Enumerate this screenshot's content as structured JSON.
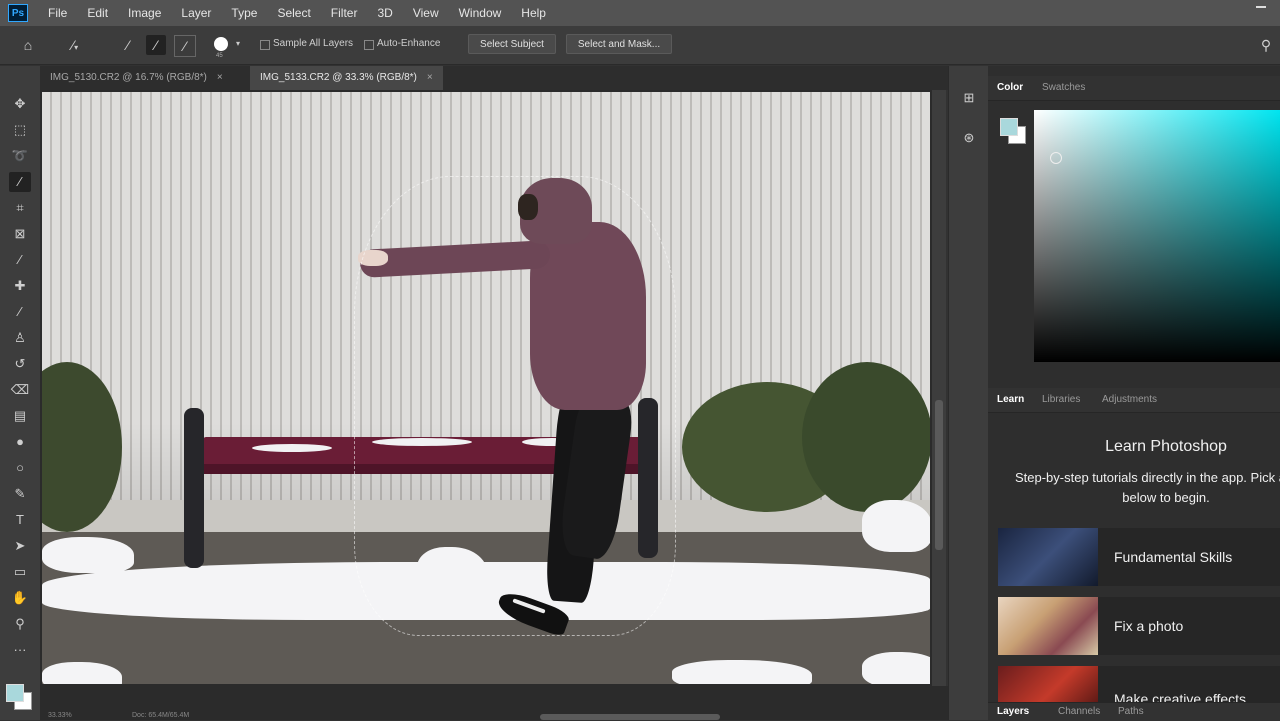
{
  "menu": {
    "logo": "Ps",
    "items": [
      "File",
      "Edit",
      "Image",
      "Layer",
      "Type",
      "Select",
      "Filter",
      "3D",
      "View",
      "Window",
      "Help"
    ]
  },
  "options": {
    "brush_size": "45",
    "sample_all_layers": "Sample All Layers",
    "auto_enhance": "Auto-Enhance",
    "select_subject": "Select Subject",
    "select_and_mask": "Select and Mask..."
  },
  "tabs": [
    {
      "label": "IMG_5130.CR2 @ 16.7% (RGB/8*)",
      "close": "×",
      "active": false
    },
    {
      "label": "IMG_5133.CR2 @ 33.3% (RGB/8*)",
      "close": "×",
      "active": true
    }
  ],
  "status": {
    "zoom": "33.33%",
    "doc": "Doc: 65.4M/65.4M"
  },
  "color_panel": {
    "tabs": [
      "Color",
      "Swatches"
    ],
    "foreground": "#a9d8dc",
    "background": "#ffffff",
    "hue": "#00e5f0"
  },
  "learn_panel": {
    "tabs": [
      "Learn",
      "Libraries",
      "Adjustments"
    ],
    "title": "Learn Photoshop",
    "subtitle": "Step-by-step tutorials directly in the app. Pick a topic below to begin.",
    "cards": [
      "Fundamental Skills",
      "Fix a photo",
      "Make creative effects"
    ]
  },
  "bottom_tabs": [
    "Layers",
    "Channels",
    "Paths"
  ],
  "icons": {
    "home": "⌂",
    "search": "⚲",
    "move": "✥",
    "marquee": "⬚",
    "lasso": "➰",
    "quick_select": "⁄",
    "crop": "⌗",
    "frame": "⊠",
    "eyedropper": "⁄",
    "healing": "✚",
    "brush": "⁄",
    "stamp": "♙",
    "history": "↺",
    "eraser": "⌫",
    "gradient": "▤",
    "blur": "●",
    "dodge": "○",
    "pen": "✎",
    "type": "T",
    "path_select": "➤",
    "shape": "▭",
    "hand": "✋",
    "zoom": "⚲",
    "more": "···",
    "panel_a": "⊞",
    "panel_b": "⊛"
  }
}
